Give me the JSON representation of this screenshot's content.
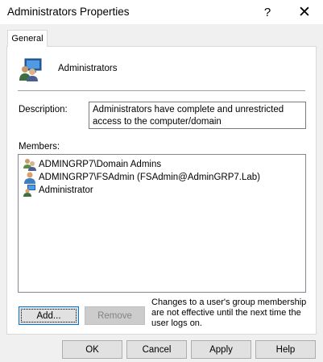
{
  "window": {
    "title": "Administrators Properties",
    "help_glyph": "?",
    "close_glyph": "✕"
  },
  "tabs": [
    {
      "label": "General"
    }
  ],
  "group": {
    "icon": "group-computer-icon",
    "name": "Administrators"
  },
  "description": {
    "label": "Description:",
    "value": "Administrators have complete and unrestricted access to the computer/domain"
  },
  "members": {
    "label": "Members:",
    "items": [
      {
        "icon": "group-icon",
        "text": "ADMINGRP7\\Domain Admins"
      },
      {
        "icon": "user-icon",
        "text": "ADMINGRP7\\FSAdmin (FSAdmin@AdminGRP7.Lab)"
      },
      {
        "icon": "user-computer-icon",
        "text": "Administrator"
      }
    ]
  },
  "buttons": {
    "add": "Add...",
    "remove": "Remove",
    "ok": "OK",
    "cancel": "Cancel",
    "apply": "Apply",
    "help": "Help"
  },
  "note": "Changes to a user's group membership are not effective until the next time the user logs on."
}
